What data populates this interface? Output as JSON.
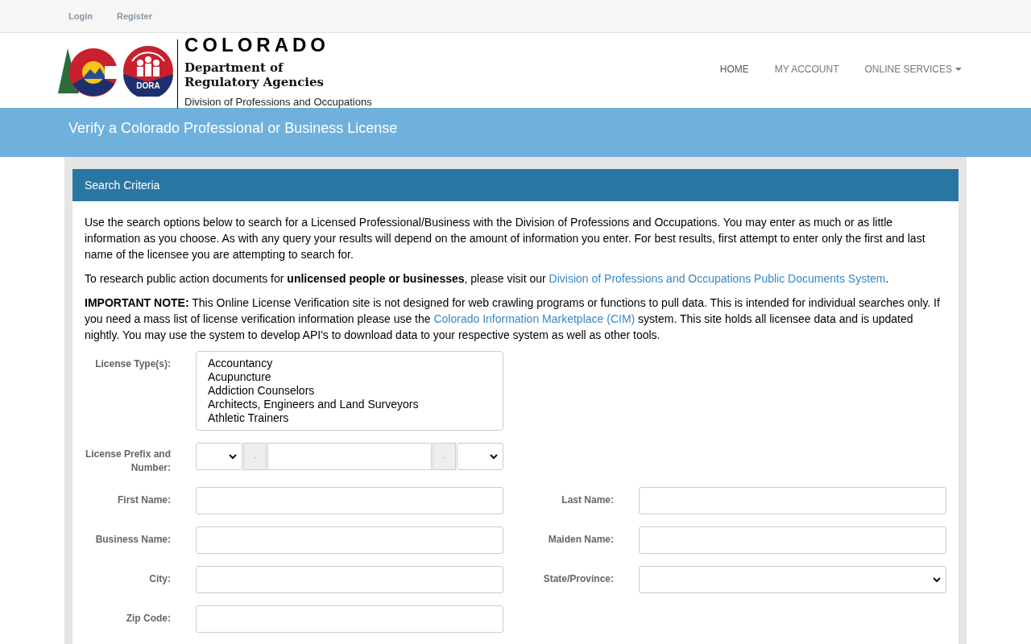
{
  "top_links": [
    "Login",
    "Register"
  ],
  "logo": {
    "badge": "DORA",
    "state": "COLORADO",
    "department": "Department of\nRegulatory Agencies",
    "division": "Division of Professions and Occupations"
  },
  "nav": [
    {
      "label": "HOME",
      "dropdown": false
    },
    {
      "label": "MY ACCOUNT",
      "dropdown": false
    },
    {
      "label": "ONLINE SERVICES",
      "dropdown": true
    }
  ],
  "banner_title": "Verify a Colorado Professional or Business License",
  "panel": {
    "title": "Search Criteria",
    "paragraphs": [
      [
        {
          "text": "Use the search options below to search for a Licensed Professional/Business with the Division of Professions and Occupations. You may enter as much or as little information as you choose. As with any query your results will depend on the amount of information you enter. For best results, first attempt to enter only the first and last name of the licensee you are attempting to search for."
        }
      ],
      [
        {
          "text": "To research public action documents for **unlicensed people or businesses**, please visit our "
        },
        {
          "text": "Division of Professions and Occupations Public Documents System",
          "link": true
        },
        {
          "text": "."
        }
      ],
      [
        {
          "text": "**IMPORTANT NOTE:** This Online License Verification site is not designed for web crawling programs or functions to pull data. This is intended for individual searches only. If you need a mass list of license verification information please use the "
        },
        {
          "text": "Colorado Information Marketplace (CIM)",
          "link": true
        },
        {
          "text": " system. This site holds all licensee data and is updated nightly. You may use the system to develop API's to download data to your respective system as well as other tools."
        }
      ]
    ],
    "license_types": {
      "label": "License Type(s):",
      "options": [
        "Accountancy",
        "Acupuncture",
        "Addiction Counselors",
        "Architects, Engineers and Land Surveyors",
        "Athletic Trainers"
      ]
    },
    "license_number": {
      "label": "License Prefix and Number:",
      "separator_1": "-",
      "separator_2": "-"
    },
    "fields": [
      {
        "label": "First Name:",
        "kind": "text"
      },
      {
        "label": "Last Name:",
        "kind": "text"
      },
      {
        "label": "Business Name:",
        "kind": "text"
      },
      {
        "label": "Maiden Name:",
        "kind": "text"
      },
      {
        "label": "City:",
        "kind": "text"
      },
      {
        "label": "State/Province:",
        "kind": "select"
      },
      {
        "label": "Zip Code:",
        "kind": "text"
      }
    ]
  }
}
